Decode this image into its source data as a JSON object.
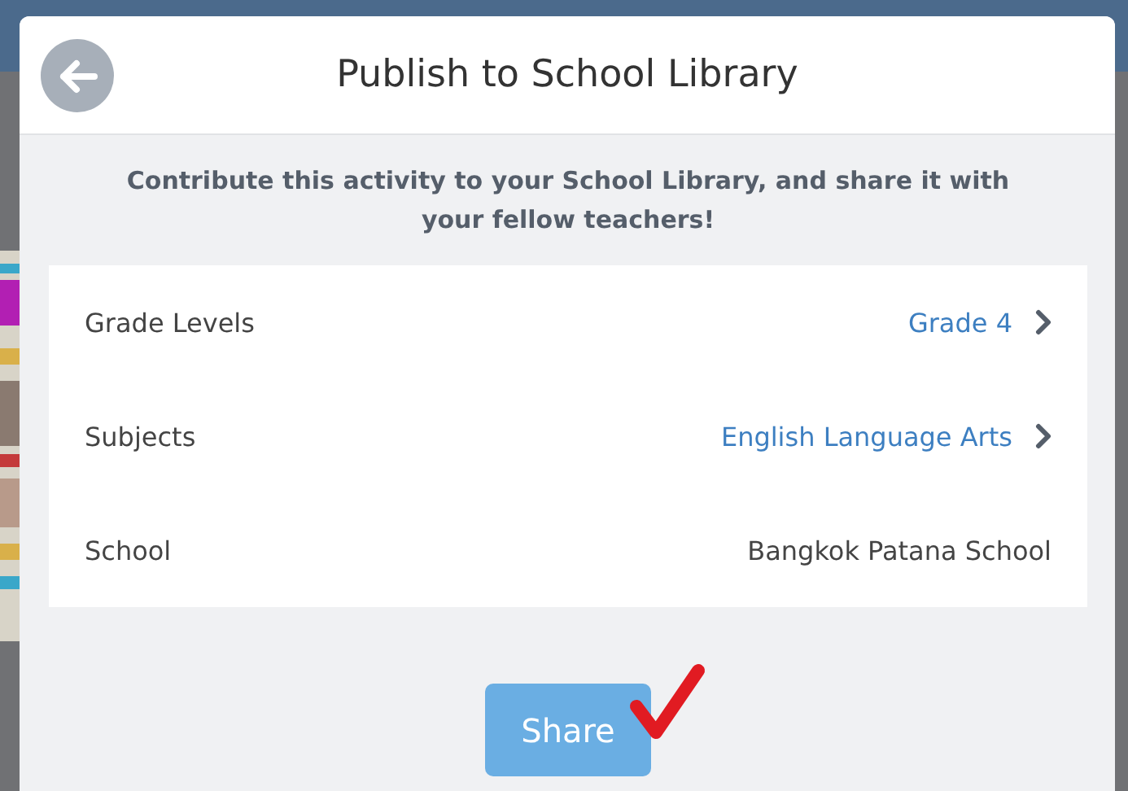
{
  "dialog": {
    "title": "Publish to School Library",
    "intro": "Contribute this activity to your School Library, and share it with your fellow teachers!",
    "fields": [
      {
        "label": "Grade Levels",
        "value": "Grade 4",
        "kind": "link"
      },
      {
        "label": "Subjects",
        "value": "English Language Arts",
        "kind": "link"
      },
      {
        "label": "School",
        "value": "Bangkok Patana School",
        "kind": "static"
      }
    ],
    "button": "Share"
  }
}
